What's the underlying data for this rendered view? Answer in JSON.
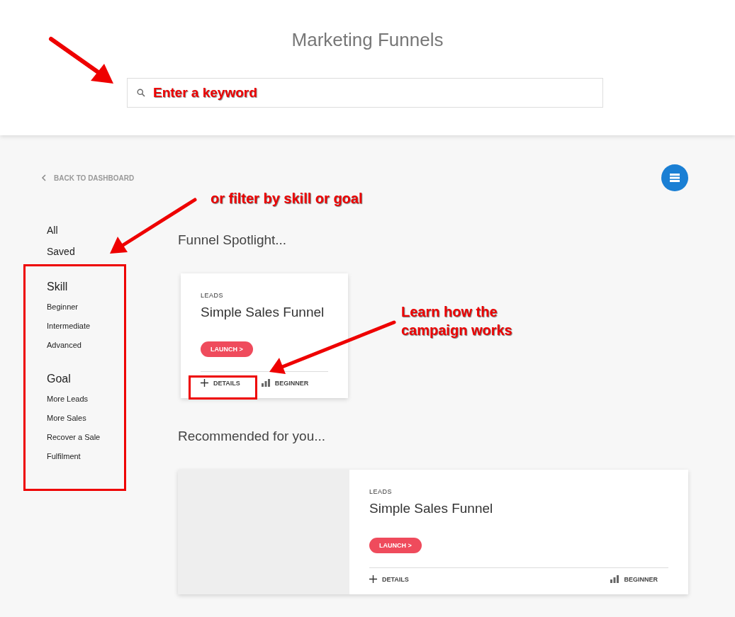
{
  "header": {
    "title": "Marketing Funnels",
    "search": {
      "placeholder": "Enter a keyword"
    }
  },
  "back_link": "BACK TO DASHBOARD",
  "sidebar": {
    "filters": [
      {
        "label": "All"
      },
      {
        "label": "Saved"
      }
    ],
    "groups": [
      {
        "heading": "Skill",
        "items": [
          "Beginner",
          "Intermediate",
          "Advanced"
        ]
      },
      {
        "heading": "Goal",
        "items": [
          "More Leads",
          "More Sales",
          "Recover a Sale",
          "Fulfilment"
        ]
      }
    ]
  },
  "sections": [
    {
      "heading": "Funnel Spotlight...",
      "card": {
        "kind": "compact",
        "category": "LEADS",
        "title": "Simple Sales Funnel",
        "launch": "LAUNCH >",
        "details": "DETAILS",
        "skill": "BEGINNER"
      }
    },
    {
      "heading": "Recommended for you...",
      "card": {
        "kind": "wide",
        "category": "LEADS",
        "title": "Simple Sales Funnel",
        "launch": "LAUNCH >",
        "details": "DETAILS",
        "skill": "BEGINNER"
      }
    }
  ],
  "annotations": [
    {
      "text": "or filter by skill or goal"
    },
    {
      "text": "Learn how the campaign works"
    }
  ]
}
